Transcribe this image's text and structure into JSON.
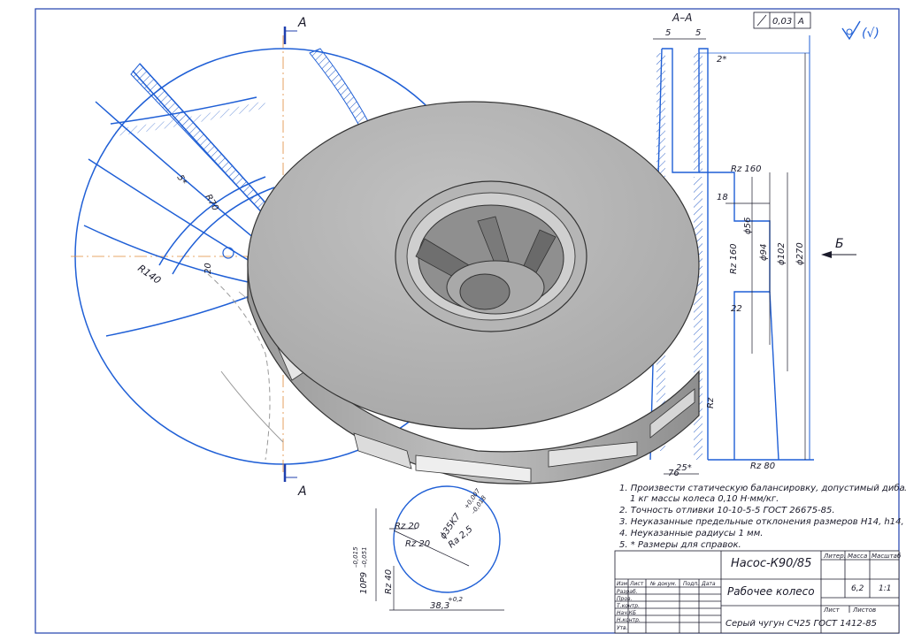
{
  "section": {
    "title": "А–А",
    "cut_label": "А",
    "view_label": "Б"
  },
  "tolerance": {
    "value": "0,03",
    "datum": "А"
  },
  "roughness_symbol": "(√)",
  "dims": {
    "r140": "R140",
    "r70": "R70",
    "d20": "20",
    "d5": "5*",
    "w5a": "5",
    "w5b": "5",
    "ang2": "2*",
    "rz160a": "Rz 160",
    "w18": "18",
    "d56": "ϕ56",
    "d94": "ϕ94",
    "d102": "ϕ102",
    "d270": "ϕ270",
    "rz160b": "Rz 160",
    "w22": "22",
    "rz": "Rz",
    "w76": "76",
    "w25": "25*",
    "rz80": "Rz 80"
  },
  "detail": {
    "rz20a": "Rz 20",
    "rz20b": "Rz 20",
    "ra25": "Ra 2,5",
    "rz40": "Rz 40",
    "bore": "ϕ35K7",
    "bore_tol_top": "+0,007",
    "bore_tol_bot": "–0,018",
    "key": "10P9",
    "key_tol_top": "–0,015",
    "key_tol_bot": "–0,051",
    "depth": "38,3",
    "depth_tol": "+0,2"
  },
  "notes": [
    "1. Произвести статическую балансировку, допустимый дибаланс на",
    "1 кг массы колеса 0,10 Н·мм/кг.",
    "2. Точность отливки 10-10-5-5 ГОСТ 26675-85.",
    "3. Неуказанные предельные отклонения размеров Н14, h14, IT±14/2.",
    "4. Неуказанные радиусы 1 мм.",
    "5. * Размеры для справок."
  ],
  "title_block": {
    "designation": "Насос-К90/85",
    "part_name": "Рабочее колесо",
    "material": "Серый чугун СЧ25 ГОСТ 1412-85",
    "col_litera": "Литер.",
    "col_mass": "Масса",
    "col_scale": "Масштаб",
    "mass": "6,2",
    "scale": "1:1",
    "sheet": "Лист",
    "sheets": "Листов",
    "header_cols": [
      "Изм.",
      "Лист",
      "№ докум.",
      "Подп.",
      "Дата"
    ],
    "rows": [
      "Разраб.",
      "Пров.",
      "Т.контр.",
      "Нач.КБ",
      "Н.контр.",
      "Утв."
    ]
  }
}
